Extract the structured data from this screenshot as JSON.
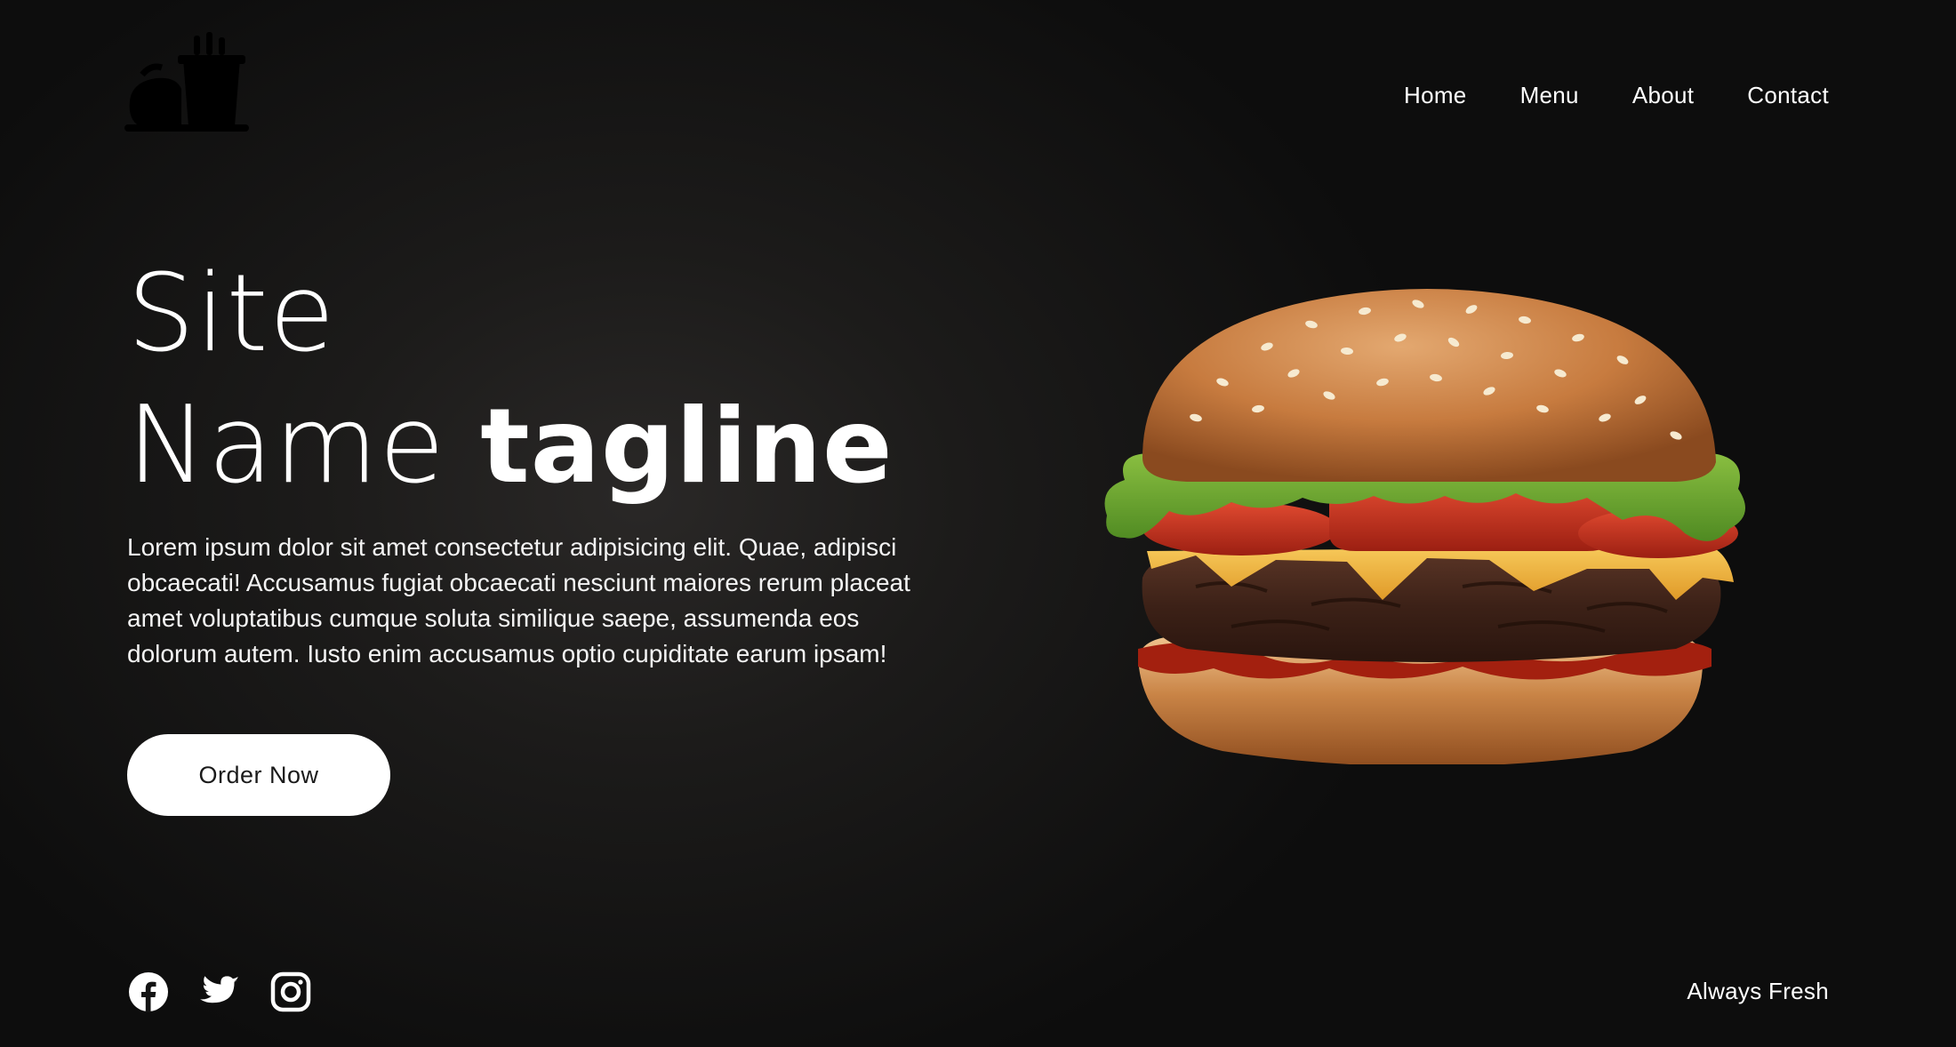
{
  "nav": {
    "items": [
      {
        "label": "Home"
      },
      {
        "label": "Menu"
      },
      {
        "label": "About"
      },
      {
        "label": "Contact"
      }
    ]
  },
  "hero": {
    "title_line1": "Site",
    "title_line2_light": "Name",
    "title_line2_bold": "tagline",
    "body": "Lorem ipsum dolor sit amet consectetur adipisicing elit. Quae, adipisci obcaecati! Accusamus fugiat obcaecati nesciunt maiores rerum placeat amet voluptatibus cumque soluta similique saepe, assumenda eos dolorum autem. Iusto enim accusamus optio cupiditate earum ipsam!",
    "cta_label": "Order Now"
  },
  "footer": {
    "socials": [
      {
        "icon": "facebook-icon"
      },
      {
        "icon": "twitter-icon"
      },
      {
        "icon": "instagram-icon"
      }
    ],
    "tagline": "Always Fresh"
  },
  "colors": {
    "background": "#111111",
    "text": "#ffffff",
    "button_bg": "#ffffff",
    "button_text": "#1a1a1a"
  }
}
